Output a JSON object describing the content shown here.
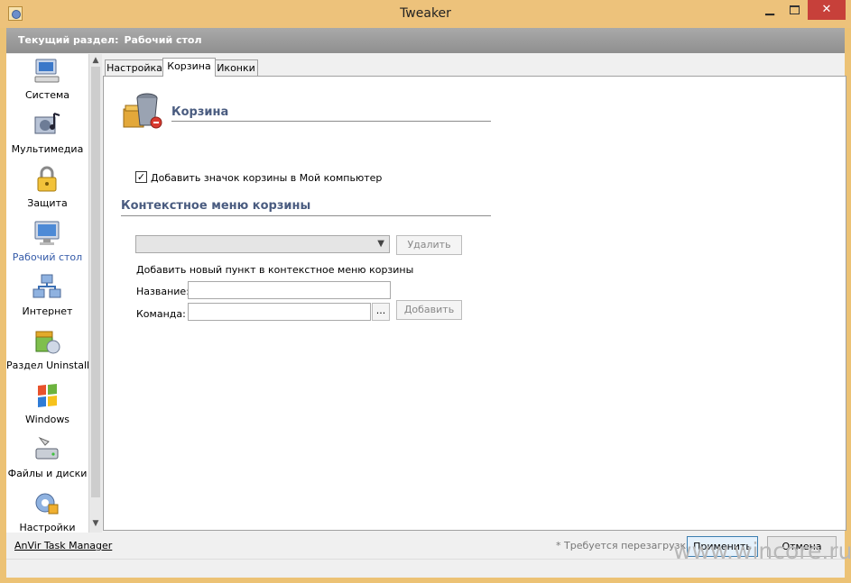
{
  "window": {
    "title": "Tweaker"
  },
  "header": {
    "prefix": "Текущий раздел:",
    "section": "Рабочий стол"
  },
  "sidebar": {
    "items": [
      {
        "label": "Система",
        "icon": "computer-icon"
      },
      {
        "label": "Мультимедиа",
        "icon": "multimedia-icon"
      },
      {
        "label": "Защита",
        "icon": "lock-icon"
      },
      {
        "label": "Рабочий стол",
        "icon": "desktop-icon",
        "active": true
      },
      {
        "label": "Интернет",
        "icon": "network-icon"
      },
      {
        "label": "Раздел Uninstall",
        "icon": "uninstall-icon"
      },
      {
        "label": "Windows",
        "icon": "windows-flag-icon"
      },
      {
        "label": "Файлы и диски",
        "icon": "drive-icon"
      },
      {
        "label": "Настройки",
        "icon": "settings-icon"
      }
    ]
  },
  "tabs": [
    {
      "label": "Настройка"
    },
    {
      "label": "Корзина",
      "active": true
    },
    {
      "label": "Иконки"
    }
  ],
  "recycle": {
    "title": "Корзина",
    "checkbox_label": "Добавить значок корзины  в Мой компьютер",
    "checkbox_checked": true,
    "context_title": "Контекстное меню корзины",
    "combo_value": "",
    "delete_button": "Удалить",
    "add_hint": "Добавить новый пункт в контекстное меню корзины",
    "name_label": "Название:",
    "command_label": "Команда:",
    "browse_button": "...",
    "add_button": "Добавить"
  },
  "status": {
    "link": "AnVir Task Manager",
    "restart_note": "* Требуется перезагрузка",
    "apply_button": "Применить",
    "cancel_button": "Отмена"
  },
  "watermark": "www.wincore.ru",
  "colors": {
    "titlebar": "#edc27b",
    "close": "#c7403a",
    "active_sidebar": "#345aa8",
    "section_title": "#4a5c80"
  }
}
